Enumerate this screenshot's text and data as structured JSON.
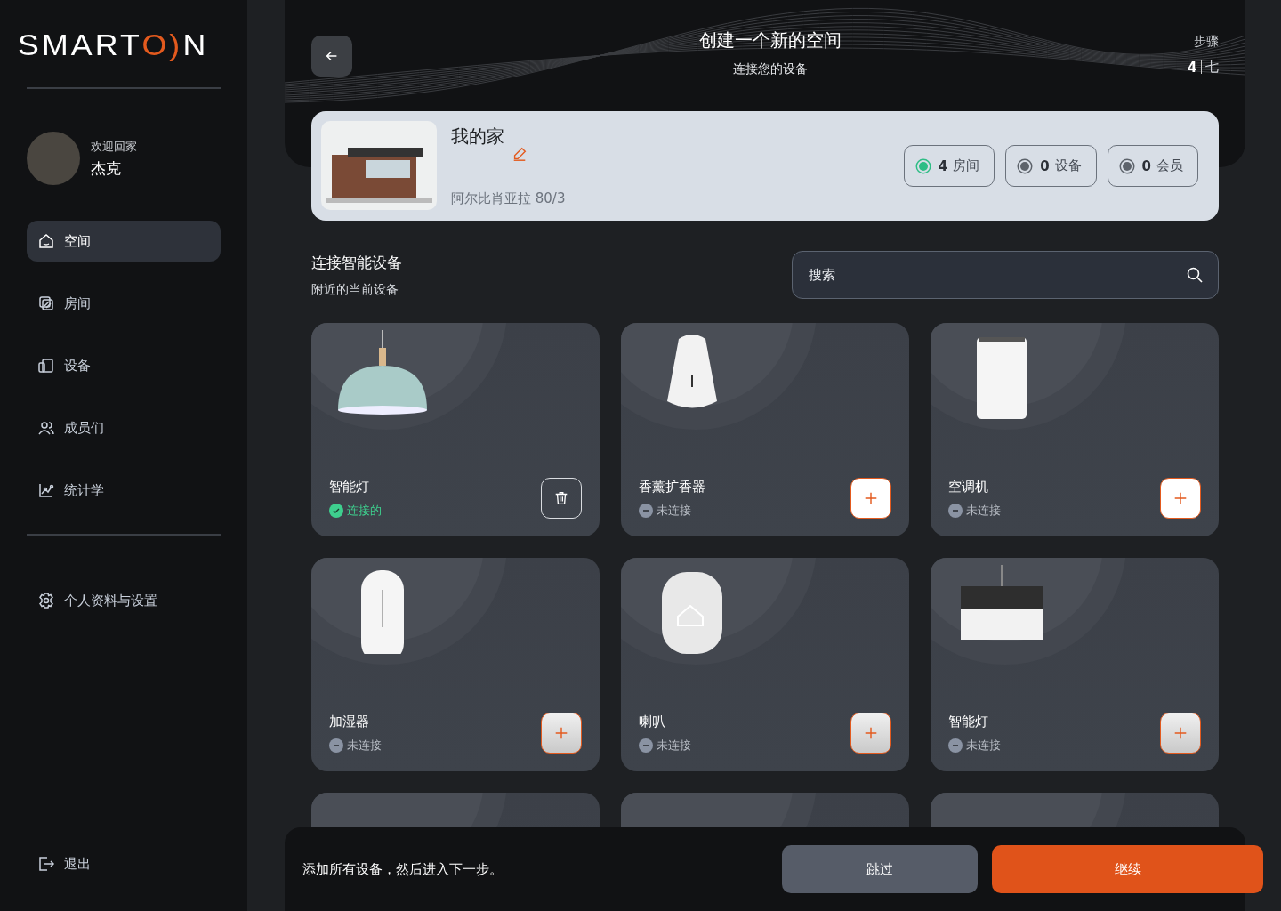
{
  "sidebar": {
    "logo": {
      "start": "SMART",
      "accent": "O)",
      "end": "N"
    },
    "user": {
      "greeting": "欢迎回家",
      "name": "杰克"
    },
    "nav": [
      {
        "kind": "home",
        "label": "空间",
        "selected": true
      },
      {
        "kind": "rooms",
        "label": "房间",
        "selected": false
      },
      {
        "kind": "devices",
        "label": "设备",
        "selected": false
      },
      {
        "kind": "members",
        "label": "成员们",
        "selected": false
      },
      {
        "kind": "stats",
        "label": "统计学",
        "selected": false
      }
    ],
    "settings": {
      "label": "个人资料与设置"
    },
    "logout": {
      "label": "退出"
    }
  },
  "header": {
    "title": "创建一个新的空间",
    "subtitle": "连接您的设备",
    "step_label": "步骤",
    "step_current": "4",
    "step_total": "七"
  },
  "home": {
    "name": "我的家",
    "address": "阿尔比肖亚拉 80/3",
    "stats": [
      {
        "count": "4",
        "label": "房间",
        "active": true
      },
      {
        "count": "0",
        "label": "设备",
        "active": false
      },
      {
        "count": "0",
        "label": "会员",
        "active": false
      }
    ]
  },
  "section": {
    "title": "连接智能设备",
    "subtitle": "附近的当前设备",
    "search_placeholder": "搜索"
  },
  "devices": [
    {
      "kind": "pendant-lamp",
      "name": "智能灯",
      "connected": true,
      "status": "连接的"
    },
    {
      "kind": "diffuser",
      "name": "香薰扩香器",
      "connected": false,
      "status": "未连接"
    },
    {
      "kind": "air-conditioner",
      "name": "空调机",
      "connected": false,
      "status": "未连接"
    },
    {
      "kind": "humidifier",
      "name": "加湿器",
      "connected": false,
      "status": "未连接"
    },
    {
      "kind": "speaker",
      "name": "喇叭",
      "connected": false,
      "status": "未连接"
    },
    {
      "kind": "drum-lamp",
      "name": "智能灯",
      "connected": false,
      "status": "未连接"
    }
  ],
  "footer": {
    "message": "添加所有设备，然后进入下一步。",
    "skip": "跳过",
    "continue": "继续"
  }
}
